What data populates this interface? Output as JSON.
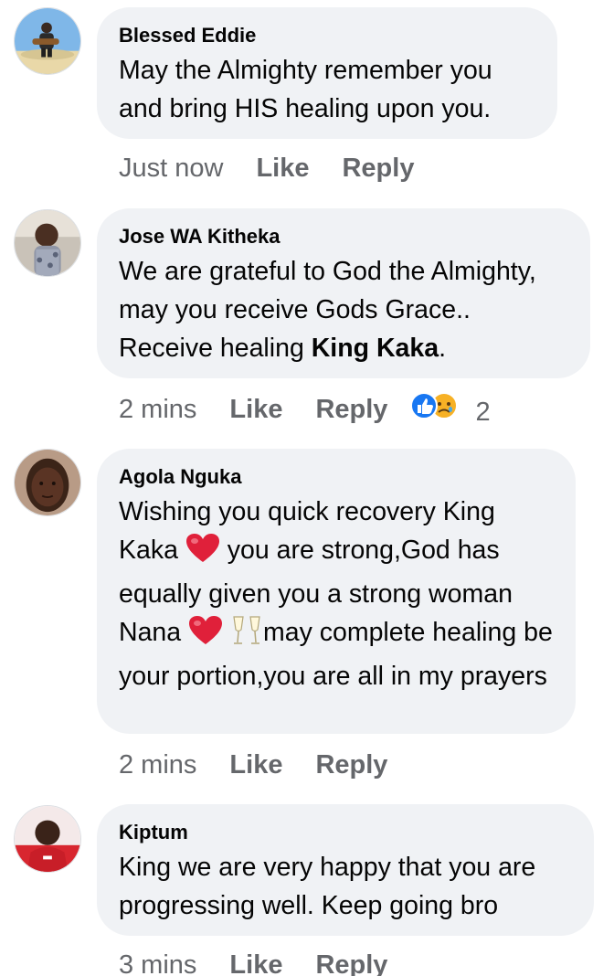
{
  "comments": [
    {
      "author": "Blessed Eddie",
      "text": "May the Almighty remember you and bring HIS healing upon you.",
      "time": "Just now",
      "like_label": "Like",
      "reply_label": "Reply"
    },
    {
      "author": "Jose WA Kitheka",
      "text_parts": [
        "We are grateful to God the Almighty, may you receive Gods Grace.. Receive healing ",
        "King Kaka",
        "."
      ],
      "time": "2 mins",
      "like_label": "Like",
      "reply_label": "Reply",
      "reactions": {
        "icons": [
          "like-reaction-icon",
          "sad-reaction-icon"
        ],
        "count": "2"
      }
    },
    {
      "author": "Agola Nguka",
      "text_parts": [
        "Wishing you quick recovery King Kaka ",
        " you are strong,God has equally given you a strong woman Nana ",
        " ",
        "may complete healing be your portion,you are all in my prayers"
      ],
      "time": "2 mins",
      "like_label": "Like",
      "reply_label": "Reply"
    },
    {
      "author": "Kiptum",
      "text": "King we are very happy that you are progressing well. Keep going bro",
      "time": "3 mins",
      "like_label": "Like",
      "reply_label": "Reply"
    }
  ],
  "colors": {
    "bubble": "#f0f2f5",
    "meta_text": "#65676b",
    "like_blue": "#1877f2",
    "heart_red": "#e0203a"
  }
}
